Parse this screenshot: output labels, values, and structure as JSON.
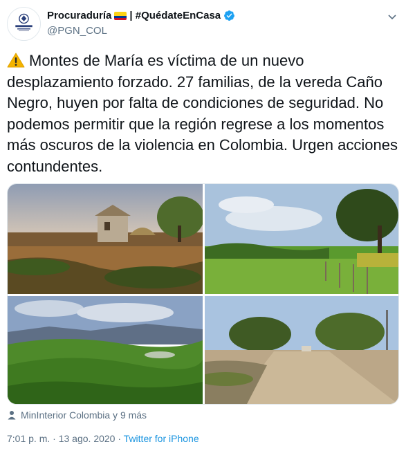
{
  "account": {
    "display_name": "Procuraduría",
    "hashtag": "| #QuédateEnCasa",
    "handle": "@PGN_COL",
    "flag_colors": [
      "#FCD116",
      "#003893",
      "#CE1126"
    ],
    "verified_color": "#1da1f2",
    "avatar_icon": "procuraduria-seal-icon"
  },
  "tweet": {
    "warning_icon": "warning-icon",
    "text": "Montes de María es víctima de un nuevo desplazamiento forzado. 27 familias, de la vereda Caño Negro, huyen por falta de condiciones de seguridad. No podemos permitir que la región regrese a los momentos más oscuros de la violencia en Colombia. Urgen acciones contundentes."
  },
  "media": {
    "photos": [
      {
        "alt": "thatched huts in rural field at sunset"
      },
      {
        "alt": "green pasture with fence and trees"
      },
      {
        "alt": "green hills under cloudy sky"
      },
      {
        "alt": "dirt road through village with trees"
      }
    ]
  },
  "tagged": {
    "icon": "person-icon",
    "text": "MinInterior Colombia y 9 más"
  },
  "meta": {
    "time": "7:01 p. m.",
    "separator": "·",
    "date": "13 ago. 2020",
    "source": "Twitter for iPhone"
  }
}
